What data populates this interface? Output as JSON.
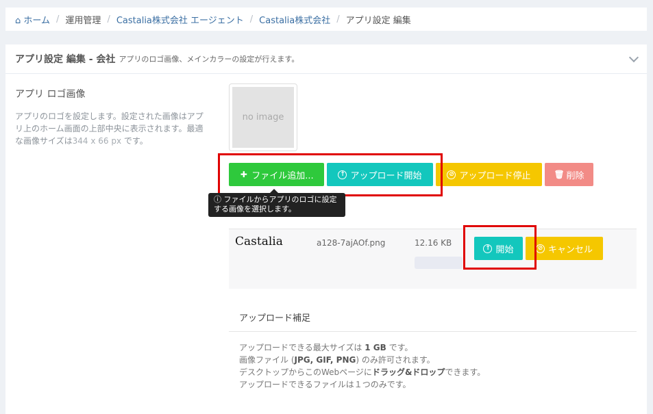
{
  "breadcrumb": {
    "home": "ホーム",
    "items": [
      "運用管理",
      "Castalia株式会社 エージェント",
      "Castalia株式会社",
      "アプリ設定 編集"
    ]
  },
  "panel": {
    "title": "アプリ設定 編集 - 会社",
    "description": "アプリのロゴ画像、メインカラーの設定が行えます。"
  },
  "logo_setting": {
    "label": "アプリ ロゴ画像",
    "help": "アプリのロゴを設定します。設定された画像はアプリ上のホーム画面の上部中央に表示されます。最適な画像サイズは",
    "size_hint": "344 x 66 px",
    "help_suffix": "です。",
    "placeholder": "no image"
  },
  "toolbar": {
    "add_file": "ファイル追加...",
    "start_upload": "アップロード開始",
    "stop_upload": "アップロード停止",
    "delete": "削除",
    "tooltip": "ファイルからアプリのロゴに設定する画像を選択します。"
  },
  "file": {
    "preview_text": "Castalia",
    "name": "a128-7ajAOf.png",
    "size": "12.16 KB",
    "progress": 0,
    "start": "開始",
    "cancel": "キャンセル"
  },
  "notes": {
    "title": "アップロード補足",
    "line1_pre": "アップロードできる最大サイズは",
    "line1_bold": "1 GB",
    "line1_post": "です。",
    "line2_pre": "画像ファイル (",
    "line2_bold": "JPG, GIF, PNG",
    "line2_post": ") のみ許可されます。",
    "line3_pre": "デスクトップからこのWebページに",
    "line3_bold": "ドラッグ&ドロップ",
    "line3_post": "できます。",
    "line4": "アップロードできるファイルは１つのみです。"
  },
  "colors": {
    "green": "#2ec93c",
    "teal": "#13c7bd",
    "yellow": "#f5c700",
    "red": "#f28b86",
    "highlight": "#e00000"
  }
}
